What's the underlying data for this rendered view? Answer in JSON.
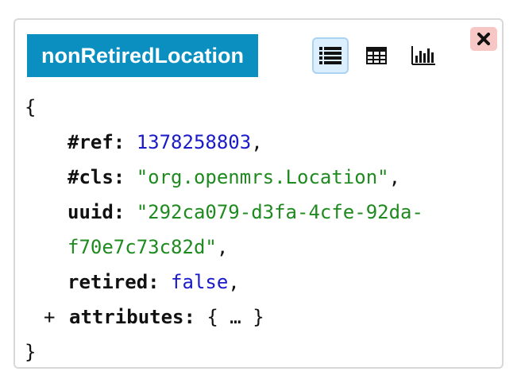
{
  "panel": {
    "title": "nonRetiredLocation",
    "views": [
      {
        "name": "list",
        "icon": "list-view-icon",
        "active": true
      },
      {
        "name": "table",
        "icon": "table-view-icon",
        "active": false
      },
      {
        "name": "chart",
        "icon": "bar-chart-icon",
        "active": false
      }
    ],
    "close_icon": "close-icon"
  },
  "object": {
    "open_brace": "{",
    "close_brace": "}",
    "ref_key": "#ref:",
    "ref_value": "1378258803",
    "cls_key": "#cls:",
    "cls_value": "\"org.openmrs.Location\"",
    "uuid_key": "uuid:",
    "uuid_value_part1": "\"292ca079-d3fa-4cfe-92da-",
    "uuid_value_part2": "f70e7c73c82d\"",
    "retired_key": "retired:",
    "retired_value": "false",
    "attributes_expander": "+",
    "attributes_key": "attributes:",
    "attributes_value": "{ … }",
    "comma": ","
  },
  "colors": {
    "title_bg": "#0a8fc0",
    "number": "#1a1ac8",
    "string": "#1f8a1f",
    "close_bg": "#f7c7c6"
  }
}
